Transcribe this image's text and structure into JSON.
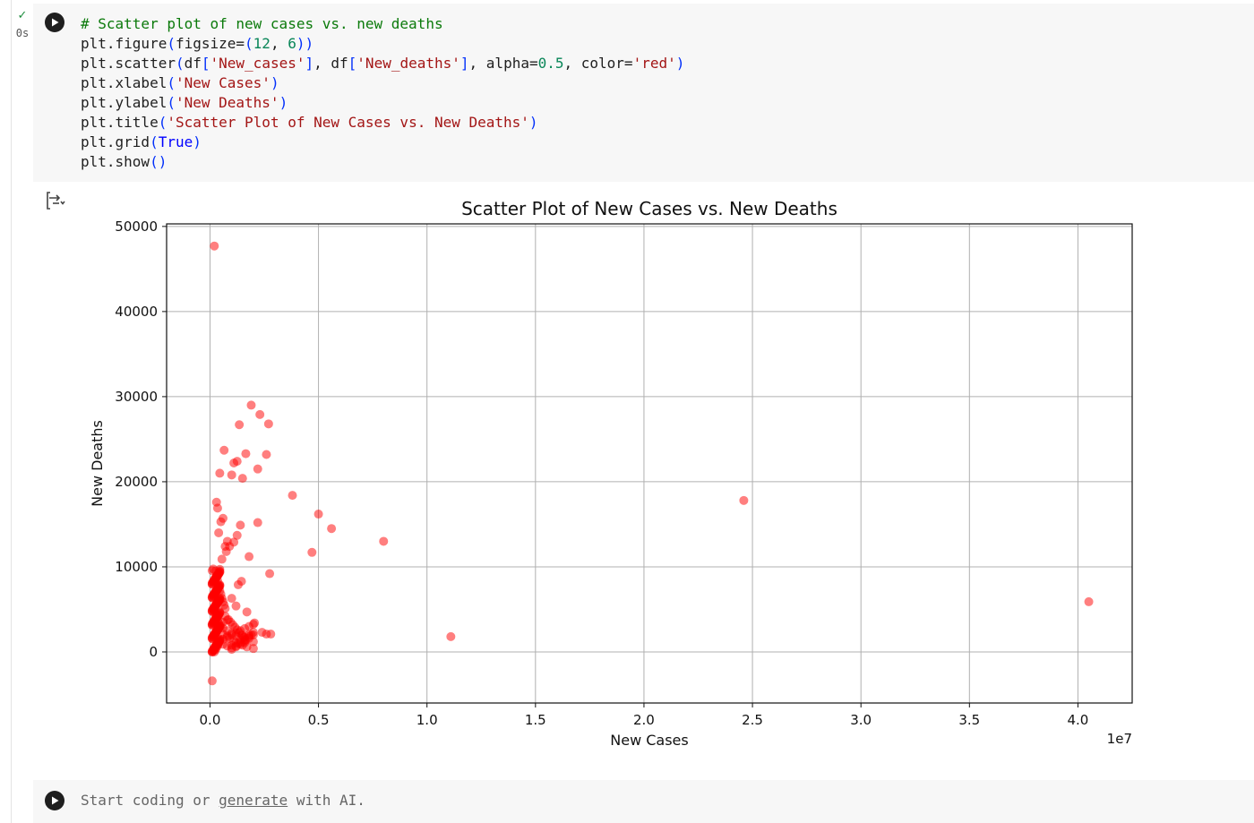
{
  "cell": {
    "status_icon": "check-icon",
    "exec_time": "0s",
    "run_icon": "play-icon",
    "code_lines": [
      [
        {
          "t": "# Scatter plot of new cases vs. new deaths",
          "k": "comment"
        }
      ],
      [
        {
          "t": "plt.figure",
          "k": "plain"
        },
        {
          "t": "(",
          "k": "paren"
        },
        {
          "t": "figsize=",
          "k": "plain"
        },
        {
          "t": "(",
          "k": "paren"
        },
        {
          "t": "12",
          "k": "number"
        },
        {
          "t": ", ",
          "k": "plain"
        },
        {
          "t": "6",
          "k": "number"
        },
        {
          "t": "))",
          "k": "paren"
        }
      ],
      [
        {
          "t": "plt.scatter",
          "k": "plain"
        },
        {
          "t": "(",
          "k": "paren"
        },
        {
          "t": "df",
          "k": "plain"
        },
        {
          "t": "[",
          "k": "paren"
        },
        {
          "t": "'New_cases'",
          "k": "string"
        },
        {
          "t": "]",
          "k": "paren"
        },
        {
          "t": ", df",
          "k": "plain"
        },
        {
          "t": "[",
          "k": "paren"
        },
        {
          "t": "'New_deaths'",
          "k": "string"
        },
        {
          "t": "]",
          "k": "paren"
        },
        {
          "t": ", alpha=",
          "k": "plain"
        },
        {
          "t": "0.5",
          "k": "number"
        },
        {
          "t": ", color=",
          "k": "plain"
        },
        {
          "t": "'red'",
          "k": "string"
        },
        {
          "t": ")",
          "k": "paren"
        }
      ],
      [
        {
          "t": "plt.xlabel",
          "k": "plain"
        },
        {
          "t": "(",
          "k": "paren"
        },
        {
          "t": "'New Cases'",
          "k": "string"
        },
        {
          "t": ")",
          "k": "paren"
        }
      ],
      [
        {
          "t": "plt.ylabel",
          "k": "plain"
        },
        {
          "t": "(",
          "k": "paren"
        },
        {
          "t": "'New Deaths'",
          "k": "string"
        },
        {
          "t": ")",
          "k": "paren"
        }
      ],
      [
        {
          "t": "plt.title",
          "k": "plain"
        },
        {
          "t": "(",
          "k": "paren"
        },
        {
          "t": "'Scatter Plot of New Cases vs. New Deaths'",
          "k": "string"
        },
        {
          "t": ")",
          "k": "paren"
        }
      ],
      [
        {
          "t": "plt.grid",
          "k": "plain"
        },
        {
          "t": "(",
          "k": "paren"
        },
        {
          "t": "True",
          "k": "kw"
        },
        {
          "t": ")",
          "k": "paren"
        }
      ],
      [
        {
          "t": "plt.show",
          "k": "plain"
        },
        {
          "t": "()",
          "k": "paren"
        }
      ]
    ]
  },
  "output": {
    "toggle_icon": "output-toggle-icon"
  },
  "chart_data": {
    "type": "scatter",
    "title": "Scatter Plot of New Cases vs. New Deaths",
    "xlabel": "New Cases",
    "ylabel": "New Deaths",
    "x_offset_label": "1e7",
    "xlim": [
      -2000000,
      42500000
    ],
    "ylim": [
      -6000,
      50300
    ],
    "xticks": [
      0,
      5000000,
      10000000,
      15000000,
      20000000,
      25000000,
      30000000,
      35000000,
      40000000
    ],
    "xtick_labels": [
      "0.0",
      "0.5",
      "1.0",
      "1.5",
      "2.0",
      "2.5",
      "3.0",
      "3.5",
      "4.0"
    ],
    "yticks": [
      0,
      10000,
      20000,
      30000,
      40000,
      50000
    ],
    "ytick_labels": [
      "0",
      "10000",
      "20000",
      "30000",
      "40000",
      "50000"
    ],
    "grid": true,
    "color": "#ff0000",
    "alpha": 0.5,
    "x": [
      200000,
      1900000,
      2300000,
      2700000,
      1350000,
      650000,
      1100000,
      1250000,
      1650000,
      2600000,
      450000,
      1000000,
      1500000,
      2200000,
      3800000,
      5000000,
      5600000,
      4700000,
      8000000,
      24600000,
      40500000,
      11100000,
      100000,
      2750000,
      2200000,
      1400000,
      1250000,
      900000,
      750000,
      800000,
      1100000,
      1800000,
      1450000,
      1300000,
      1000000,
      1200000,
      2050000,
      2400000,
      2600000,
      2800000,
      1700000,
      1900000,
      1500000,
      1600000,
      300000,
      350000,
      500000,
      400000,
      600000,
      700000,
      550000,
      450000,
      250000,
      300000,
      350000,
      400000,
      450000,
      500000,
      550000,
      600000,
      650000,
      700000,
      200000,
      250000,
      300000,
      350000,
      400000,
      500000,
      600000,
      800000,
      1000000,
      1200000,
      900000,
      1100000,
      1300000,
      1500000,
      1700000,
      2000000,
      700000,
      850000,
      950000,
      1050000,
      1150000,
      1250000,
      1350000,
      1450000,
      1550000,
      1650000,
      100000,
      150000,
      200000,
      250000,
      300000,
      350000,
      400000,
      450000,
      100000,
      150000,
      200000,
      250000,
      300000,
      350000,
      400000,
      450000,
      100000,
      150000,
      200000,
      250000,
      300000,
      350000,
      400000,
      450000,
      100000,
      150000,
      200000,
      250000,
      300000,
      350000,
      400000,
      450000,
      100000,
      150000,
      200000,
      250000,
      300000,
      350000,
      400000,
      450000,
      100000,
      150000,
      200000,
      250000,
      300000,
      350000,
      400000,
      450000,
      100000,
      150000,
      200000,
      250000,
      300000,
      350000,
      400000,
      450000,
      100000,
      150000,
      200000,
      250000,
      300000,
      350000,
      400000,
      450000,
      100000,
      150000,
      200000,
      250000,
      300000,
      350000,
      400000,
      450000,
      100000,
      150000,
      200000,
      250000,
      300000,
      350000,
      400000,
      450000,
      100000,
      150000,
      200000,
      250000,
      300000,
      350000,
      400000,
      450000,
      100000,
      150000,
      200000,
      250000,
      300000,
      350000,
      400000,
      450000,
      100000,
      150000,
      200000,
      250000,
      300000,
      350000,
      400000,
      450000,
      100000,
      150000,
      200000,
      250000,
      300000,
      350000,
      400000,
      450000,
      100000,
      150000,
      200000,
      250000,
      300000,
      350000,
      400000,
      450000,
      100000,
      150000,
      200000,
      250000,
      300000,
      350000,
      400000,
      450000,
      100000,
      150000,
      200000,
      250000,
      300000,
      350000,
      400000,
      450000,
      100000,
      150000,
      200000,
      250000,
      300000,
      350000,
      400000,
      450000,
      100000,
      150000,
      200000,
      250000,
      300000,
      350000,
      400000,
      450000,
      600000,
      800000,
      1000000,
      1200000,
      1400000,
      1600000,
      1800000,
      2000000,
      600000,
      800000,
      1000000,
      1200000,
      1400000,
      1600000,
      1800000,
      2000000,
      600000,
      800000,
      1000000,
      1200000,
      1400000,
      1600000,
      1800000,
      2000000,
      600000,
      800000,
      1000000,
      1200000,
      1400000,
      1600000,
      1800000,
      2000000
    ],
    "y": [
      47700,
      29000,
      27900,
      26800,
      26700,
      23700,
      22200,
      22400,
      23300,
      23200,
      21000,
      20800,
      20400,
      21500,
      18400,
      16200,
      14500,
      11700,
      13000,
      17800,
      5900,
      1800,
      -3400,
      9200,
      15200,
      14900,
      13700,
      12400,
      11800,
      13000,
      12900,
      11200,
      8300,
      7900,
      6300,
      5400,
      3400,
      2300,
      2100,
      2100,
      4700,
      2000,
      1900,
      1100,
      17600,
      16900,
      15300,
      14000,
      15700,
      12400,
      10900,
      9700,
      9500,
      8900,
      8400,
      7800,
      7200,
      6800,
      6300,
      5900,
      5500,
      5100,
      4800,
      4400,
      4100,
      3700,
      3400,
      3100,
      2800,
      2500,
      2200,
      1900,
      1600,
      1300,
      1000,
      800,
      600,
      400,
      4200,
      3800,
      3500,
      3200,
      2900,
      2600,
      2300,
      2000,
      1700,
      1400,
      0,
      200,
      400,
      600,
      800,
      1000,
      1200,
      1400,
      1600,
      1800,
      2000,
      2200,
      2400,
      2600,
      2800,
      3000,
      3200,
      3400,
      3600,
      3800,
      4000,
      4200,
      4400,
      4600,
      4800,
      5000,
      5200,
      5400,
      5600,
      5800,
      6000,
      6200,
      6400,
      6600,
      6800,
      7000,
      7200,
      7400,
      7600,
      7800,
      8000,
      8200,
      8400,
      8600,
      8800,
      9000,
      9200,
      9400,
      100,
      300,
      500,
      700,
      900,
      1100,
      1300,
      1500,
      1700,
      1900,
      2100,
      2300,
      2500,
      2700,
      2900,
      3100,
      3300,
      3500,
      3700,
      3900,
      4100,
      4300,
      4500,
      4700,
      4900,
      5100,
      5300,
      5500,
      5700,
      5900,
      6100,
      6300,
      6500,
      6700,
      6900,
      7100,
      7300,
      7500,
      7700,
      7900,
      8100,
      8300,
      8500,
      8700,
      8900,
      9100,
      9300,
      9500,
      0,
      150,
      350,
      550,
      750,
      950,
      1150,
      1350,
      1550,
      1750,
      1950,
      2150,
      2350,
      2550,
      2750,
      2950,
      3150,
      3350,
      3550,
      3750,
      3950,
      4150,
      4350,
      4550,
      4750,
      4950,
      5150,
      5350,
      5550,
      5750,
      5950,
      6150,
      6350,
      6550,
      6750,
      6950,
      7150,
      7350,
      7550,
      7750,
      7950,
      8150,
      8350,
      8550,
      8750,
      8950,
      9150,
      9350,
      9550,
      9750,
      0,
      250,
      500,
      750,
      1000,
      1250,
      1500,
      1750,
      2000,
      2250,
      2500,
      2750,
      3000,
      3250,
      3500,
      3750,
      800,
      1100,
      1400,
      1700,
      2000,
      2300,
      2100,
      1900,
      500,
      700,
      900,
      1300,
      1600,
      1200,
      900,
      700,
      300,
      600,
      1100,
      1500,
      1800,
      2000,
      1400,
      1000
    ]
  },
  "new_cell": {
    "run_icon": "play-icon",
    "placeholder_pre": "Start coding or ",
    "placeholder_link": "generate",
    "placeholder_post": " with AI."
  }
}
